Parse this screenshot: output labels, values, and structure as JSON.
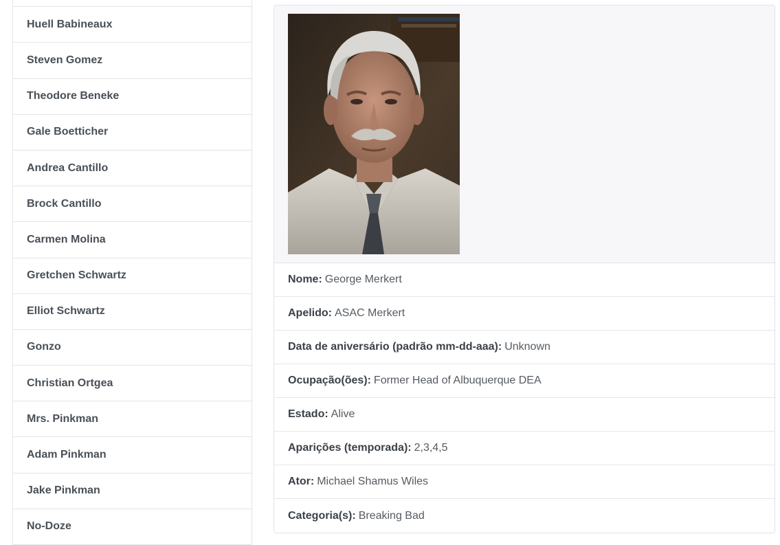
{
  "sidebar": {
    "items": [
      {
        "label": ""
      },
      {
        "label": "Huell Babineaux"
      },
      {
        "label": "Steven Gomez"
      },
      {
        "label": "Theodore Beneke"
      },
      {
        "label": "Gale Boetticher"
      },
      {
        "label": "Andrea Cantillo"
      },
      {
        "label": "Brock Cantillo"
      },
      {
        "label": "Carmen Molina"
      },
      {
        "label": "Gretchen Schwartz"
      },
      {
        "label": "Elliot Schwartz"
      },
      {
        "label": "Gonzo"
      },
      {
        "label": "Christian Ortgea"
      },
      {
        "label": "Mrs. Pinkman"
      },
      {
        "label": "Adam Pinkman"
      },
      {
        "label": "Jake Pinkman"
      },
      {
        "label": "No-Doze"
      }
    ]
  },
  "character": {
    "details": [
      {
        "label": "Nome:",
        "value": "George Merkert"
      },
      {
        "label": "Apelido:",
        "value": "ASAC Merkert"
      },
      {
        "label": "Data de aniversário (padrão mm-dd-aaa):",
        "value": "Unknown"
      },
      {
        "label": "Ocupação(ões):",
        "value": "Former Head of Albuquerque DEA"
      },
      {
        "label": "Estado:",
        "value": "Alive"
      },
      {
        "label": "Aparições (temporada):",
        "value": "2,3,4,5"
      },
      {
        "label": "Ator:",
        "value": "Michael Shamus Wiles"
      },
      {
        "label": "Categoria(s):",
        "value": "Breaking Bad"
      }
    ]
  },
  "colors": {
    "text": "#495057",
    "border": "#e1e4e8",
    "header_bg": "#f7f7f9"
  }
}
